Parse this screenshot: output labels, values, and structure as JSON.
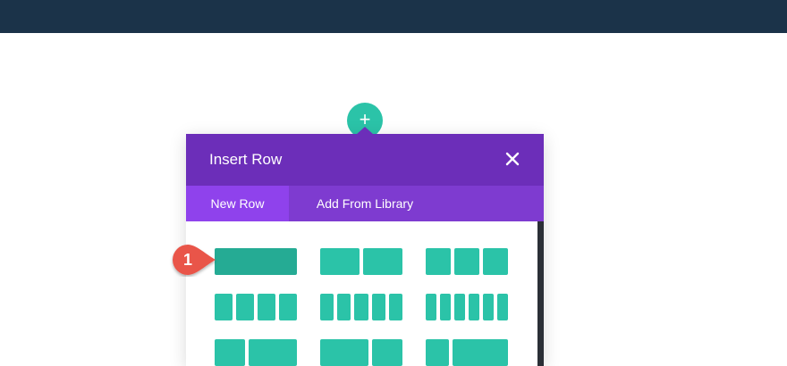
{
  "modal": {
    "title": "Insert Row",
    "close_icon": "close-icon"
  },
  "add_button": {
    "symbol": "+"
  },
  "tabs": [
    {
      "label": "New Row",
      "active": true
    },
    {
      "label": "Add From Library",
      "active": false
    }
  ],
  "callout": {
    "number": "1",
    "color": "#e9554a"
  },
  "colors": {
    "topbar": "#1b3349",
    "header": "#6c2eb9",
    "tabs": "#7e3bd0",
    "tab_active": "#8f42ec",
    "accent": "#2bc3a8"
  },
  "layouts": [
    {
      "name": "1 column",
      "selected": true
    },
    {
      "name": "2 columns"
    },
    {
      "name": "3 columns"
    },
    {
      "name": "4 columns"
    },
    {
      "name": "5 columns"
    },
    {
      "name": "6 columns"
    },
    {
      "name": "1/3 + 2/3"
    },
    {
      "name": "2/3 + 1/3"
    },
    {
      "name": "1/4 + 3/4"
    }
  ]
}
